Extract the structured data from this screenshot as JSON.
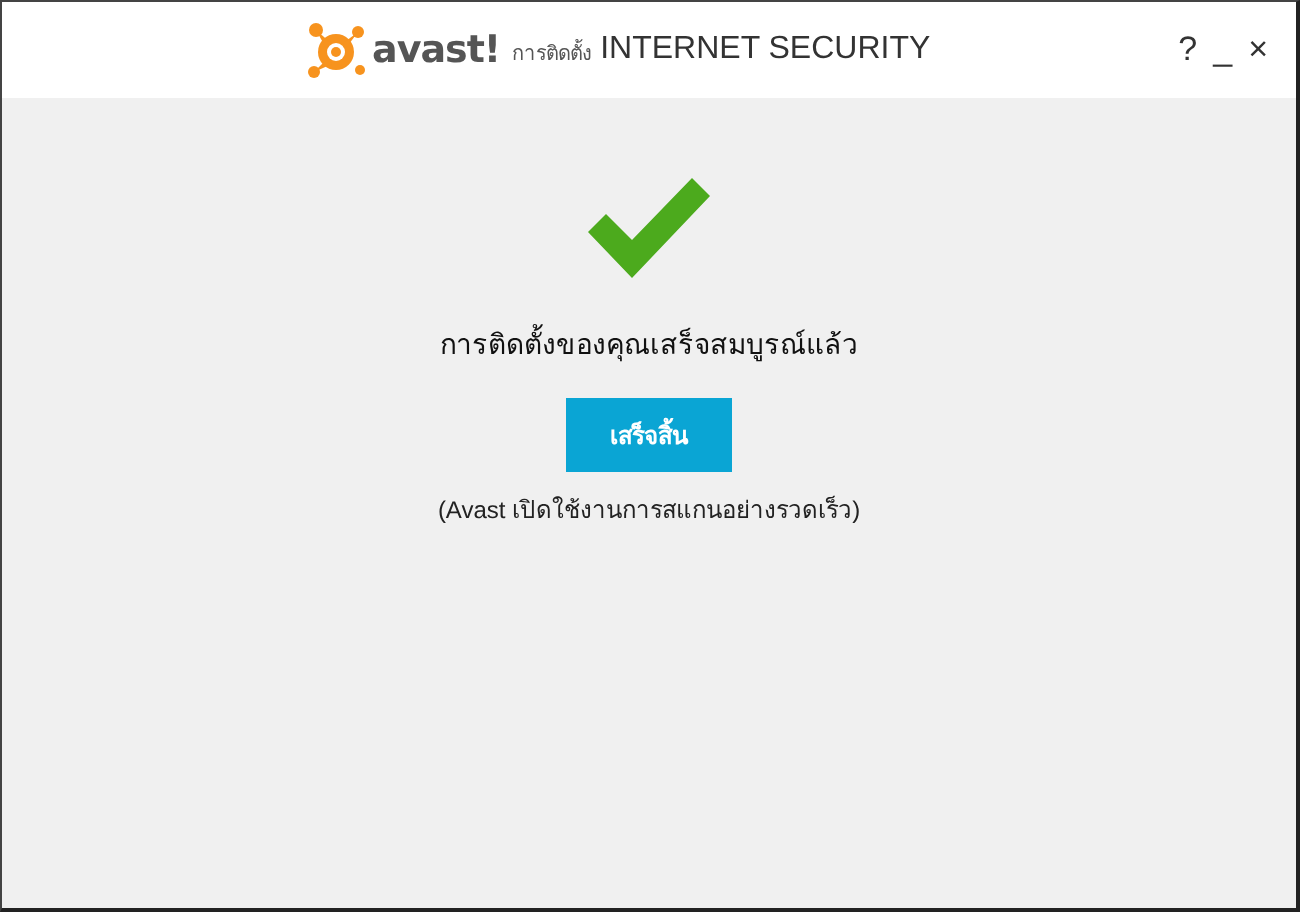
{
  "window": {
    "brand": "avast!",
    "subtitle": "การติดตั้ง",
    "title": "INTERNET SECURITY",
    "controls": [
      "?",
      "_",
      "×"
    ]
  },
  "message": "การติดตั้งของคุณเสร็จสมบูรณ์แล้ว",
  "button": "เสร็จสิ้น",
  "note": "(Avast เปิดใช้งานการสแกนอย่างรวดเร็ว)"
}
